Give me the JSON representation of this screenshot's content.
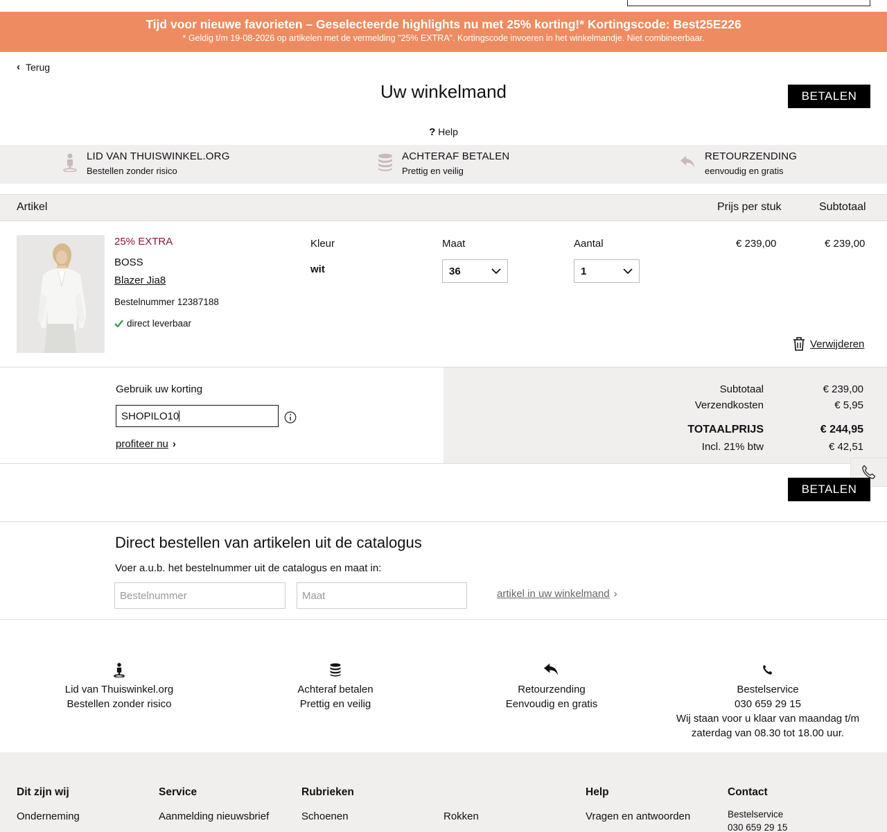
{
  "promo": {
    "line1": "Tijd voor nieuwe favorieten – Geselecteerde highlights nu met 25% korting!* Kortingscode: Best25E226",
    "line2": "* Geldig t/m 19-08-2026 op artikelen met de vermelding \"25% EXTRA\". Kortingscode invoeren in het winkelmandje. Niet combineerbaar.",
    "bg_color": "#ef8b60"
  },
  "nav": {
    "back_label": "Terug"
  },
  "page": {
    "title": "Uw winkelmand",
    "pay_label": "BETALEN",
    "help_label": "Help"
  },
  "usps": [
    {
      "icon": "map-pin-person-icon",
      "title": "LID VAN THUISWINKEL.ORG",
      "sub": "Bestellen zonder risico"
    },
    {
      "icon": "coin-stack-icon",
      "title": "ACHTERAF BETALEN",
      "sub": "Prettig en veilig"
    },
    {
      "icon": "return-arrow-icon",
      "title": "RETOURZENDING",
      "sub": "eenvoudig en gratis"
    }
  ],
  "table": {
    "col_article": "Artikel",
    "col_price": "Prijs per stuk",
    "col_subtotal": "Subtotaal"
  },
  "item": {
    "badge": "25% EXTRA",
    "badge_color": "#8a1538",
    "brand": "BOSS",
    "name": "Blazer Jia8",
    "order_number": "Bestelnummer 12387188",
    "availability": "direct leverbaar",
    "color_label": "Kleur",
    "color_value": "wit",
    "size_label": "Maat",
    "size_value": "36",
    "qty_label": "Aantal",
    "qty_value": "1",
    "price": "€ 239,00",
    "subtotal": "€ 239,00",
    "remove_label": "Verwijderen"
  },
  "coupon": {
    "label": "Gebruik uw korting",
    "value": "SHOPILO10",
    "profit_label": "profiteer nu"
  },
  "totals": {
    "subtotal_label": "Subtotaal",
    "subtotal_value": "€ 239,00",
    "shipping_label": "Verzendkosten",
    "shipping_value": "€ 5,95",
    "total_label": "TOTAALPRIJS",
    "total_value": "€ 244,95",
    "vat_label": "Incl. 21% btw",
    "vat_value": "€ 42,51"
  },
  "catalog": {
    "title": "Direct bestellen van artikelen uit de catalogus",
    "subtitle": "Voer a.u.b. het bestelnummer uit de catalogus en maat in:",
    "order_placeholder": "Bestelnummer",
    "size_placeholder": "Maat",
    "add_label": "artikel in uw winkelmand"
  },
  "services": [
    {
      "icon": "map-pin-person-icon",
      "line1": "Lid van Thuiswinkel.org",
      "line2": "Bestellen zonder risico"
    },
    {
      "icon": "coin-stack-icon",
      "line1": "Achteraf betalen",
      "line2": "Prettig en veilig"
    },
    {
      "icon": "return-arrow-icon",
      "line1": "Retourzending",
      "line2": "Eenvoudig en gratis"
    },
    {
      "icon": "phone-icon",
      "line1": "Bestelservice",
      "line2": "030 659 29 15",
      "line3": "Wij staan voor u klaar van maandag t/m",
      "line4": "zaterdag van 08.30 tot 18.00 uur."
    }
  ],
  "footer": {
    "col1": {
      "heading": "Dit zijn wij",
      "item": "Onderneming"
    },
    "col2": {
      "heading": "Service",
      "item": "Aanmelding nieuwsbrief"
    },
    "col3": {
      "heading": "Rubrieken",
      "item": "Schoenen",
      "item2": "Rokken"
    },
    "col4": {
      "heading": "Help",
      "item": "Vragen en antwoorden"
    },
    "col5": {
      "heading": "Contact",
      "item": "Bestelservice",
      "item2": "030 659 29 15"
    }
  }
}
